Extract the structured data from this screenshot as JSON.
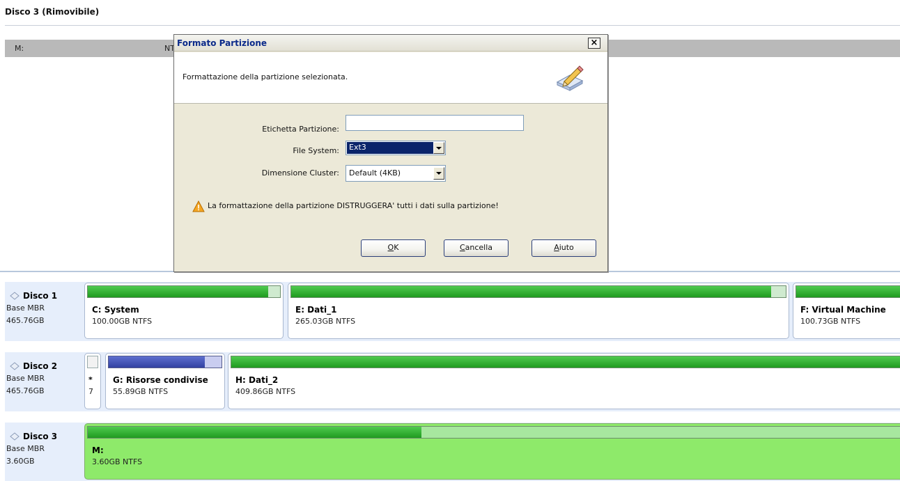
{
  "top": {
    "disk_header": "Disco 3 (Rimovibile)",
    "partition_row": {
      "drive": "M:",
      "fs": "NTFS"
    }
  },
  "dialog": {
    "title": "Formato Partizione",
    "close_label": "×",
    "description": "Formattazione della partizione selezionata.",
    "label_partition": "Etichetta Partizione:",
    "partition_label_value": "",
    "label_filesystem": "File System:",
    "filesystem_value": "Ext3",
    "label_cluster": "Dimensione Cluster:",
    "cluster_value": "Default (4KB)",
    "warning": "La formattazione della partizione DISTRUGGERA' tutti i dati sulla partizione!",
    "buttons": {
      "ok": {
        "mnemonic": "O",
        "rest": "K"
      },
      "cancel": {
        "mnemonic": "C",
        "rest": "ancella"
      },
      "help": {
        "mnemonic": "A",
        "rest": "iuto"
      }
    }
  },
  "disks": [
    {
      "name": "Disco 1",
      "type": "Base MBR",
      "size": "465.76GB",
      "partitions": [
        {
          "name": "C: System",
          "detail": "100.00GB NTFS",
          "used_fraction": 0.94
        },
        {
          "name": "E: Dati_1",
          "detail": "265.03GB NTFS",
          "used_fraction": 0.97
        },
        {
          "name": "F: Virtual Machine",
          "detail": "100.73GB NTFS",
          "used_fraction": 1.0
        }
      ]
    },
    {
      "name": "Disco 2",
      "type": "Base MBR",
      "size": "465.76GB",
      "partitions": [
        {
          "name": "*",
          "detail": "7",
          "used_fraction": 0
        },
        {
          "name": "G: Risorse condivise",
          "detail": "55.89GB NTFS",
          "used_fraction": 0.85
        },
        {
          "name": "H: Dati_2",
          "detail": "409.86GB NTFS",
          "used_fraction": 1.0
        }
      ]
    },
    {
      "name": "Disco 3",
      "type": "Base MBR",
      "size": "3.60GB",
      "partitions": [
        {
          "name": "M:",
          "detail": "3.60GB NTFS",
          "used_fraction": 0.41
        }
      ]
    }
  ],
  "colors": {
    "used_bar": "#2aa82a",
    "selected_partition": "#8eea6a",
    "shared_bar": "#3f4fb5",
    "dialog_title": "#0b2a8a",
    "selection_highlight": "#0a246a"
  }
}
